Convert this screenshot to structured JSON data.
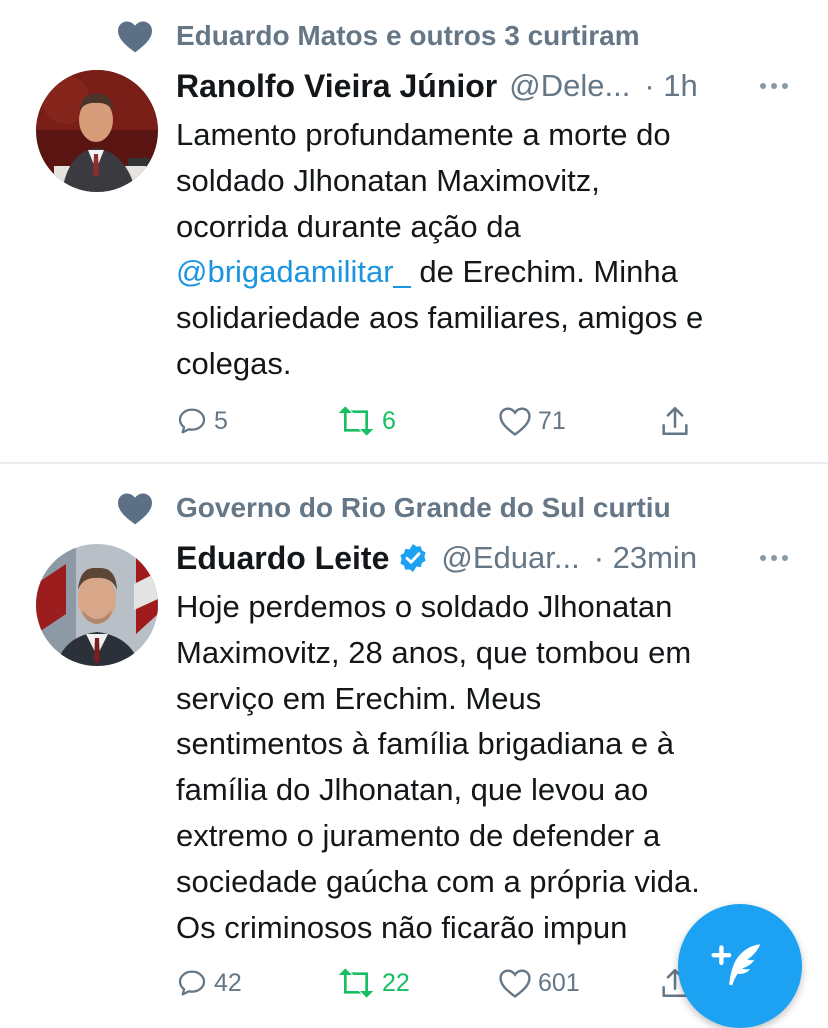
{
  "tweets": [
    {
      "social_context": "Eduardo Matos e outros 3 curtiram",
      "name": "Ranolfo Vieira Júnior",
      "verified": false,
      "handle": "@Dele...",
      "time": "· 1h",
      "text_before": "Lamento profundamente a morte do\nsoldado Jlhonatan Maximovitz,\nocorrida durante ação da\n",
      "mention": "@brigadamilitar_",
      "text_after": " de Erechim. Minha\nsolidariedade aos familiares, amigos e\ncolegas.",
      "replies": "5",
      "retweets": "6",
      "likes": "71"
    },
    {
      "social_context": "Governo do Rio Grande do Sul curtiu",
      "name": "Eduardo Leite",
      "verified": true,
      "handle": "@Eduar...",
      "time": "· 23min",
      "text_before": "Hoje perdemos o soldado Jlhonatan\nMaximovitz, 28 anos, que tombou em\nserviço em Erechim. Meus\nsentimentos à família brigadiana e à\nfamília do Jlhonatan, que levou ao\nextremo o juramento de defender a\nsociedade gaúcha com a própria vida.\nOs criminosos não ficarão impun",
      "mention": "",
      "text_after": "",
      "replies": "42",
      "retweets": "22",
      "likes": "601"
    }
  ],
  "icons": {
    "liked": "heart-filled-icon",
    "verified": "verified-badge-icon",
    "more": "more-dots-icon",
    "reply": "reply-bubble-icon",
    "retweet": "retweet-icon",
    "like": "heart-outline-icon",
    "share": "share-icon",
    "compose": "compose-tweet-icon"
  },
  "colors": {
    "secondary_text": "#657786",
    "link": "#1b95e0",
    "retweet": "#17bf63",
    "fab": "#1da1f2",
    "social_heart": "#5b6f85"
  }
}
